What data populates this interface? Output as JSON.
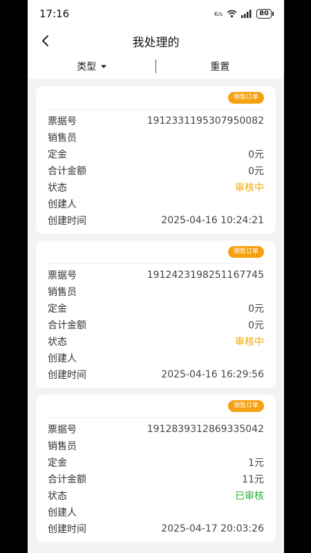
{
  "status_bar": {
    "time": "17:16",
    "network_speed": "K/s",
    "battery": "80"
  },
  "header": {
    "title": "我处理的"
  },
  "filter": {
    "type_label": "类型",
    "reset_label": "重置"
  },
  "labels": {
    "ticket_no": "票据号",
    "salesperson": "销售员",
    "deposit": "定金",
    "total_amount": "合计金额",
    "status": "状态",
    "creator": "创建人",
    "created_time": "创建时间"
  },
  "orders": [
    {
      "badge": "销售订单",
      "ticket_no": "1912331195307950082",
      "salesperson": "",
      "deposit": "0元",
      "total_amount": "0元",
      "status": "审核中",
      "creator": "",
      "created_time": "2025-04-16 10:24:21"
    },
    {
      "badge": "销售订单",
      "ticket_no": "1912423198251167745",
      "salesperson": "",
      "deposit": "0元",
      "total_amount": "0元",
      "status": "审核中",
      "creator": "",
      "created_time": "2025-04-16 16:29:56"
    },
    {
      "badge": "销售订单",
      "ticket_no": "1912839312869335042",
      "salesperson": "",
      "deposit": "1元",
      "total_amount": "11元",
      "status": "已审核",
      "creator": "",
      "created_time": "2025-04-17 20:03:26"
    }
  ],
  "colors": {
    "badge": "#f5a010",
    "status_pending": "#f0a800",
    "status_approved": "#2fae3a"
  }
}
